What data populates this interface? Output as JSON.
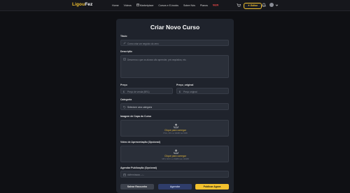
{
  "header": {
    "logo_part1": "Ligou",
    "logo_part2": "Fez",
    "nav": [
      "Home",
      "Vídeos",
      "Marketplace",
      "Cursos e E-books",
      "Sobre Nós",
      "Planos"
    ],
    "nav_badge": "NEW",
    "action_button": "Editor",
    "colors": {
      "brand": "#f2c12e",
      "badge": "#e54646"
    }
  },
  "form": {
    "title": "Criar Novo Curso",
    "fields": {
      "titulo": {
        "label": "Título",
        "placeholder": "Como criar um negócio do zero"
      },
      "descricao": {
        "label": "Descrição",
        "placeholder": "Descreva o que os alunos vão aprender, pré-requisitos, etc."
      },
      "preco": {
        "label": "Preço",
        "placeholder": "Preço de venda (BRL)"
      },
      "preco_original": {
        "label": "Preço_original",
        "placeholder": "Preço original"
      },
      "categoria": {
        "label": "Categoria",
        "value": "Selecione uma categoria"
      },
      "imagem_capa": {
        "label": "Imagem de Capa do Curso",
        "upload_text": "Clique para carregar",
        "upload_hint": "PNG, JPG ou WEBP até 5MB"
      },
      "video_apresentacao": {
        "label": "Vídeo de Apresentação (Opcional)",
        "upload_text": "Clique para carregar",
        "upload_hint": "MP4, MOV ou WEBM até 100MB"
      },
      "agendar_publicacao": {
        "label": "Agendar Publicação (Opcional)",
        "placeholder": "dd/mm/aaaa --:--"
      }
    },
    "buttons": {
      "draft": "Salvar Rascunho",
      "schedule": "Agendar",
      "publish": "Publicar Agora"
    }
  }
}
